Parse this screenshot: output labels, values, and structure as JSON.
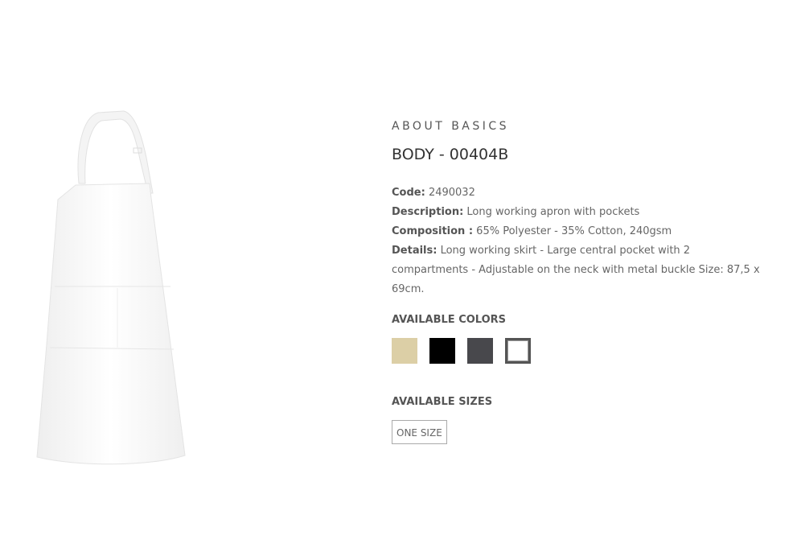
{
  "product": {
    "brand": "ABOUT BASICS",
    "title": "BODY - 00404B",
    "code_label": "Code:",
    "code_value": "2490032",
    "description_label": "Description:",
    "description_value": "Long working apron with pockets",
    "composition_label": "Composition :",
    "composition_value": "65% Polyester - 35% Cotton, 240gsm",
    "details_label": "Details:",
    "details_value": "Long working skirt - Large central pocket with 2 compartments - Adjustable on the neck with metal buckle Size: 87,5 x 69cm."
  },
  "colors": {
    "title": "AVAILABLE COLORS",
    "swatches": [
      "#dccfa6",
      "#000000",
      "#48484c",
      "#ffffff"
    ]
  },
  "sizes": {
    "title": "AVAILABLE SIZES",
    "options": [
      "ONE SIZE"
    ]
  }
}
